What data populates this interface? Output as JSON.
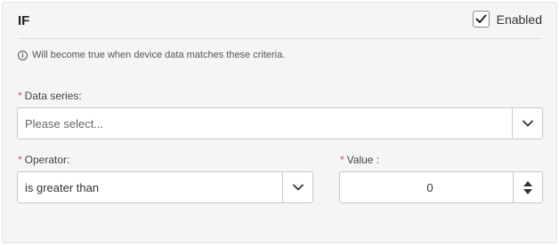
{
  "header": {
    "title": "IF",
    "enabled_label": "Enabled",
    "enabled_checked": true
  },
  "hint": {
    "icon": "info-icon",
    "text": "Will become true when device data matches these criteria."
  },
  "form": {
    "required_marker": "*",
    "data_series": {
      "label": "Data series:",
      "placeholder": "Please select..."
    },
    "operator": {
      "label": "Operator:",
      "value": "is greater than"
    },
    "value": {
      "label": "Value :",
      "value": "0"
    }
  },
  "colors": {
    "required": "#d9534f",
    "panel_bg": "#f5f5f5"
  }
}
